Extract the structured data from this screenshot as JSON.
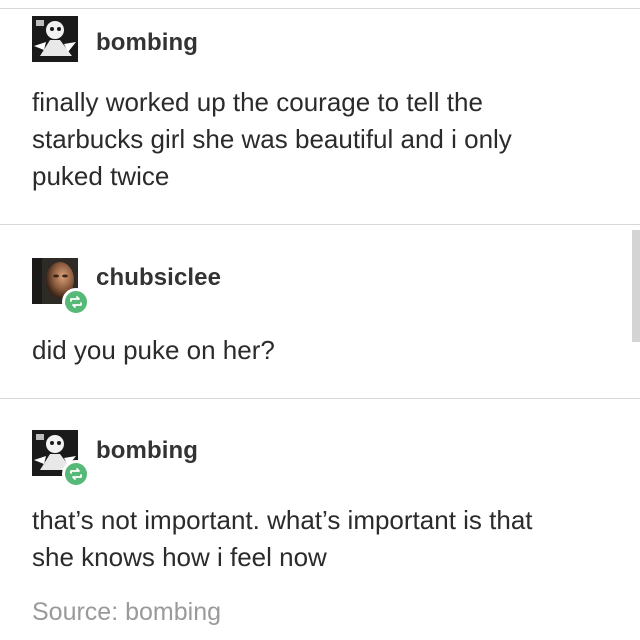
{
  "posts": [
    {
      "username": "bombing",
      "text": "finally worked up the courage to tell the starbucks girl she was beautiful and i only puked twice",
      "avatar_icon": "bw-illustration-avatar-icon",
      "reblog": false
    },
    {
      "username": "chubsiclee",
      "text": "did you puke on her?",
      "avatar_icon": "photo-avatar-icon",
      "reblog": true
    },
    {
      "username": "bombing",
      "text": "that’s not important. what’s important is that she knows how i feel now",
      "avatar_icon": "bw-illustration-avatar-icon",
      "reblog": true
    }
  ],
  "source_label": "Source: bombing",
  "colors": {
    "reblog_badge": "#56b978",
    "username": "#333333",
    "body_text": "#2b2b2b",
    "source_text": "#9a9a9a",
    "divider": "#d8d8d8"
  }
}
